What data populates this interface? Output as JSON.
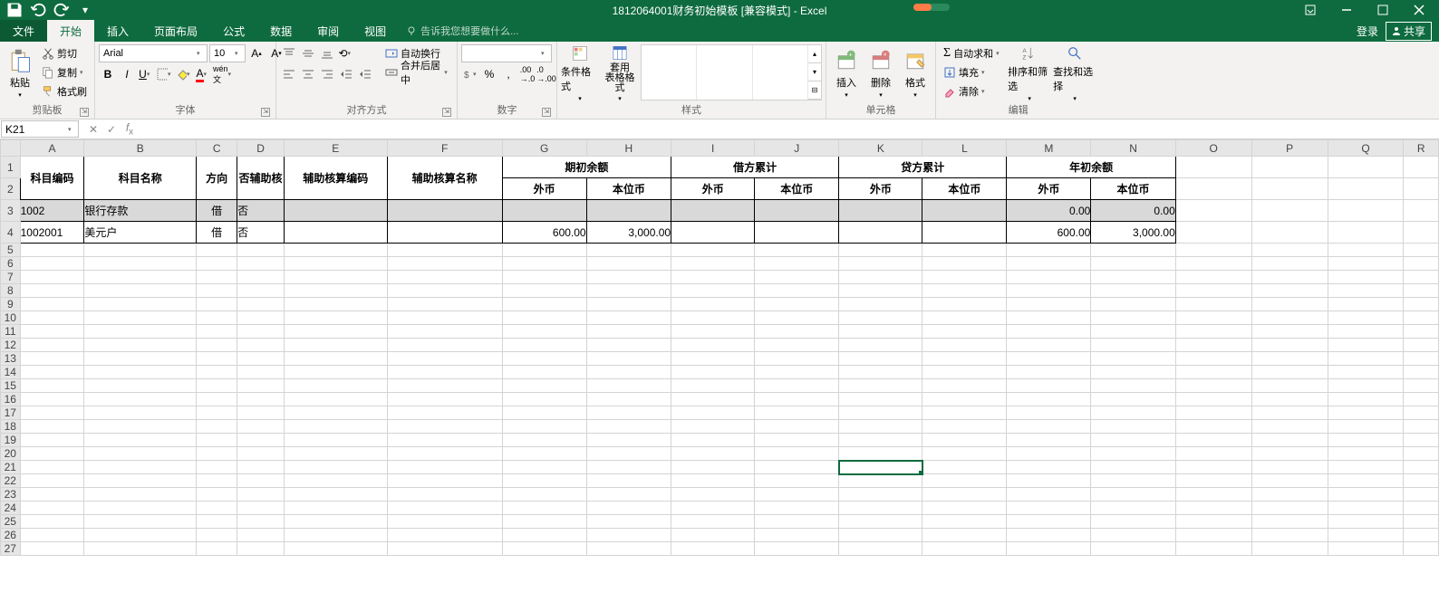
{
  "title": "1812064001财务初始模板 [兼容模式] - Excel",
  "menu": {
    "file": "文件",
    "home": "开始",
    "insert": "插入",
    "layout": "页面布局",
    "formulas": "公式",
    "data": "数据",
    "review": "审阅",
    "view": "视图",
    "tellme": "告诉我您想要做什么...",
    "login": "登录",
    "share": "共享"
  },
  "ribbon": {
    "clipboard": {
      "paste": "粘贴",
      "cut": "剪切",
      "copy": "复制",
      "painter": "格式刷",
      "label": "剪贴板"
    },
    "font": {
      "name": "Arial",
      "size": "10",
      "label": "字体"
    },
    "align": {
      "wrap": "自动换行",
      "merge": "合并后居中",
      "label": "对齐方式"
    },
    "number": {
      "label": "数字"
    },
    "styles": {
      "cond": "条件格式",
      "table": "套用\n表格格式",
      "label": "样式"
    },
    "cells": {
      "insert": "插入",
      "delete": "删除",
      "format": "格式",
      "label": "单元格"
    },
    "editing": {
      "sum": "自动求和",
      "fill": "填充",
      "clear": "清除",
      "sort": "排序和筛选",
      "find": "查找和选择",
      "label": "编辑"
    }
  },
  "namebox": "K21",
  "columns": [
    "A",
    "B",
    "C",
    "D",
    "E",
    "F",
    "G",
    "H",
    "I",
    "J",
    "K",
    "L",
    "M",
    "N",
    "O",
    "P",
    "Q",
    "R"
  ],
  "headers": {
    "r1": {
      "A": "科目编码",
      "B": "科目名称",
      "C": "方向",
      "D": "否辅助核",
      "E": "辅助核算编码",
      "F": "辅助核算名称",
      "GH": "期初余额",
      "IJ": "借方累计",
      "KL": "贷方累计",
      "MN": "年初余额"
    },
    "r2": {
      "G": "外币",
      "H": "本位币",
      "I": "外币",
      "J": "本位币",
      "K": "外币",
      "L": "本位币",
      "M": "外币",
      "N": "本位币"
    }
  },
  "rows": [
    {
      "A": "1002",
      "B": "银行存款",
      "C": "借",
      "D": "否",
      "E": "",
      "F": "",
      "G": "",
      "H": "",
      "I": "",
      "J": "",
      "K": "",
      "L": "",
      "M": "0.00",
      "N": "0.00",
      "shaded": true
    },
    {
      "A": "1002001",
      "B": "美元户",
      "C": "借",
      "D": "否",
      "E": "",
      "F": "",
      "G": "600.00",
      "H": "3,000.00",
      "I": "",
      "J": "",
      "K": "",
      "L": "",
      "M": "600.00",
      "N": "3,000.00",
      "shaded": false
    }
  ],
  "selected": {
    "col": "K",
    "row": 21
  }
}
